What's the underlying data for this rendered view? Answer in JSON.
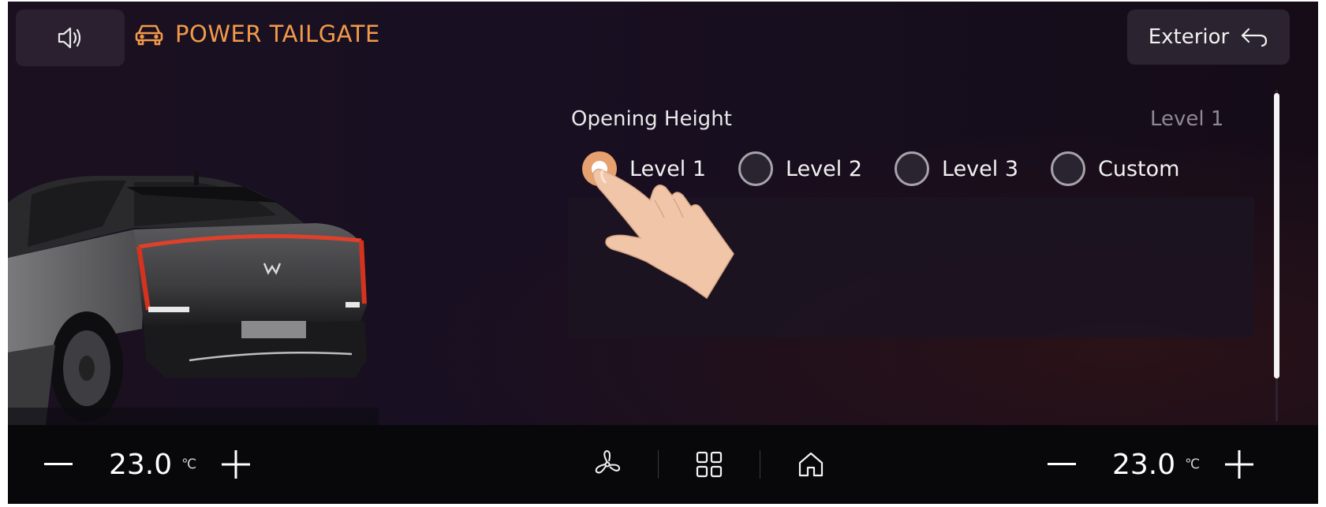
{
  "header": {
    "title": "POWER TAILGATE",
    "exterior_label": "Exterior",
    "sound_icon": "speaker-icon",
    "title_icon": "car-icon",
    "back_icon": "back-arrow-icon"
  },
  "settings": {
    "opening_label": "Opening Height",
    "current_value": "Level 1",
    "options": [
      {
        "label": "Level 1",
        "selected": true
      },
      {
        "label": "Level 2",
        "selected": false
      },
      {
        "label": "Level 3",
        "selected": false
      },
      {
        "label": "Custom",
        "selected": false
      }
    ]
  },
  "climate": {
    "left_temp": "23.0",
    "right_temp": "23.0",
    "unit": "℃"
  },
  "bottom_icons": [
    "fan-icon",
    "apps-grid-icon",
    "home-icon"
  ],
  "colors": {
    "accent": "#f29a4a",
    "selected_radio": "#e7a06f",
    "background": "#180f22"
  }
}
